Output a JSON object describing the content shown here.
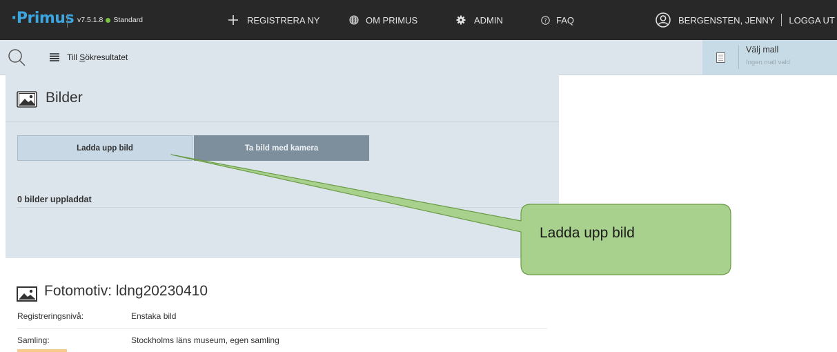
{
  "topnav": {
    "logo": "·Primus",
    "version": "v7.5.1.8",
    "edition": "Standard",
    "register_new": "REGISTRERA NY",
    "about": "OM PRIMUS",
    "admin": "ADMIN",
    "faq": "FAQ",
    "user": "BERGENSTEN, JENNY",
    "logout": "LOGGA UT"
  },
  "toolbar": {
    "results_prefix": "Till ",
    "results_underlined": "S",
    "results_rest": "ökresultatet"
  },
  "template": {
    "title": "Välj mall",
    "subtitle": "Ingen mall vald"
  },
  "images": {
    "title": "Bilder",
    "upload_button": "Ladda upp bild",
    "camera_button": "Ta bild med kamera",
    "count_text": "0 bilder uppladdat"
  },
  "callout": {
    "text": "Ladda upp bild",
    "fill": "#a9d18e",
    "stroke": "#6a9c46"
  },
  "record": {
    "title": "Fotomotiv: ldng20230410",
    "rows": [
      {
        "label": "Registreringsnivå:",
        "value": "Enstaka bild"
      },
      {
        "label": "Samling:",
        "value": "Stockholms läns museum, egen samling"
      }
    ]
  }
}
